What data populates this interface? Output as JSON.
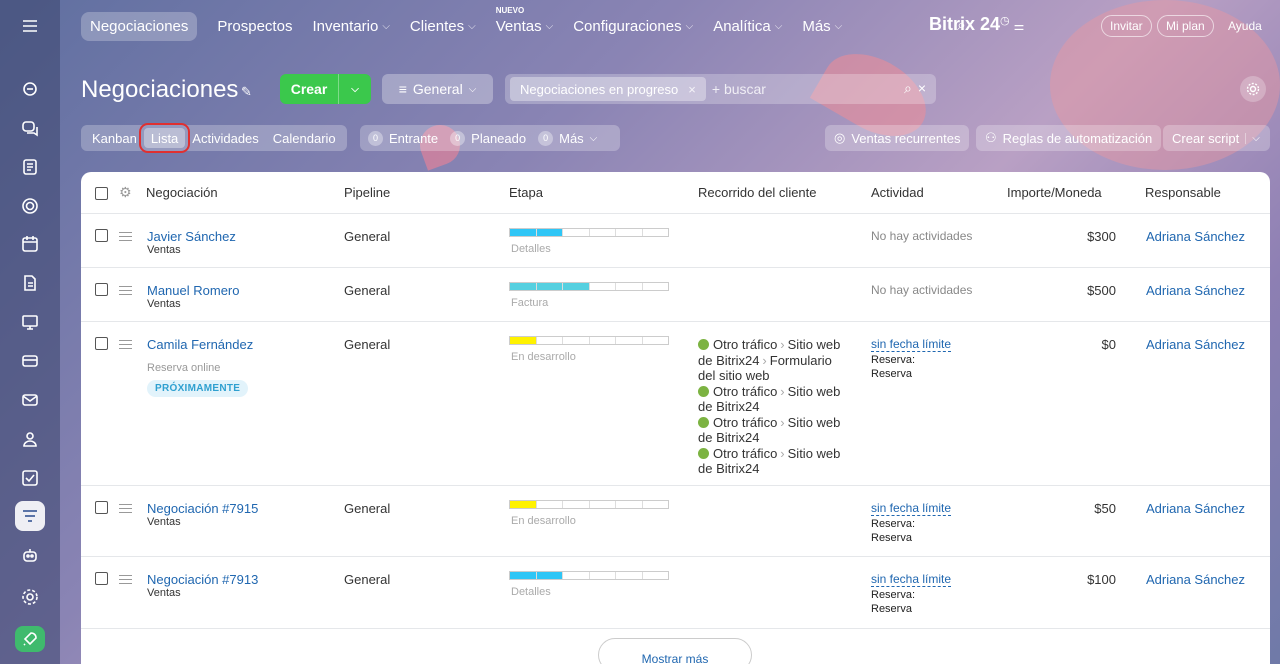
{
  "topnav": {
    "items": [
      "Negociaciones",
      "Prospectos",
      "Inventario",
      "Clientes",
      "Ventas",
      "Configuraciones",
      "Analítica",
      "Más"
    ],
    "new_badge": "NUEVO",
    "brand": "Bitrix 24",
    "invite": "Invitar",
    "plan": "Mi plan",
    "help": "Ayuda"
  },
  "header": {
    "title": "Negociaciones",
    "create_label": "Crear",
    "general_label": "General",
    "filter_chip": "Negociaciones en progreso",
    "search_placeholder": "+ buscar"
  },
  "view_tabs": [
    "Kanban",
    "Lista",
    "Actividades",
    "Calendario"
  ],
  "counters": [
    {
      "count": "0",
      "label": "Entrante"
    },
    {
      "count": "0",
      "label": "Planeado"
    },
    {
      "count": "0",
      "label": "Más"
    }
  ],
  "actions": {
    "recurring": "Ventas recurrentes",
    "automation": "Reglas de automatización",
    "script": "Crear script"
  },
  "columns": [
    "Negociación",
    "Pipeline",
    "Etapa",
    "Recorrido del cliente",
    "Actividad",
    "Importe/Moneda",
    "Responsable"
  ],
  "rows": [
    {
      "name": "Javier Sánchez",
      "sub": "Ventas",
      "pipeline": "General",
      "stage": "Detalles",
      "stage_color": "#2fc6f6",
      "stage_fill": 2,
      "activity": "No hay actividades",
      "amount": "$300",
      "owner": "Adriana Sánchez"
    },
    {
      "name": "Manuel Romero",
      "sub": "Ventas",
      "pipeline": "General",
      "stage": "Factura",
      "stage_color": "#55d0e0",
      "stage_fill": 3,
      "activity": "No hay actividades",
      "amount": "$500",
      "owner": "Adriana Sánchez"
    },
    {
      "name": "Camila Fernández",
      "sub": "Reserva online",
      "badge": "PRÓXIMAMENTE",
      "pipeline": "General",
      "stage": "En desarrollo",
      "stage_color": "#fff200",
      "stage_fill": 1,
      "activity_link": "sin fecha límite",
      "activity_sub1": "Reserva:",
      "activity_sub2": "Reserva",
      "amount": "$0",
      "owner": "Adriana Sánchez",
      "journey": {
        "first_a": "Otro tráfico",
        "first_b": "Sitio web de Bitrix24",
        "first_c": "Formulario del sitio web",
        "repeat_a": "Otro tráfico",
        "repeat_b": "Sitio web de Bitrix24"
      }
    },
    {
      "name": "Negociación #7915",
      "sub": "Ventas",
      "pipeline": "General",
      "stage": "En desarrollo",
      "stage_color": "#fff200",
      "stage_fill": 1,
      "activity_link": "sin fecha límite",
      "activity_sub1": "Reserva:",
      "activity_sub2": "Reserva",
      "amount": "$50",
      "owner": "Adriana Sánchez"
    },
    {
      "name": "Negociación #7913",
      "sub": "Ventas",
      "pipeline": "General",
      "stage": "Detalles",
      "stage_color": "#2fc6f6",
      "stage_fill": 2,
      "activity_link": "sin fecha límite",
      "activity_sub1": "Reserva:",
      "activity_sub2": "Reserva",
      "amount": "$100",
      "owner": "Adriana Sánchez"
    }
  ],
  "show_more": "Mostrar más"
}
